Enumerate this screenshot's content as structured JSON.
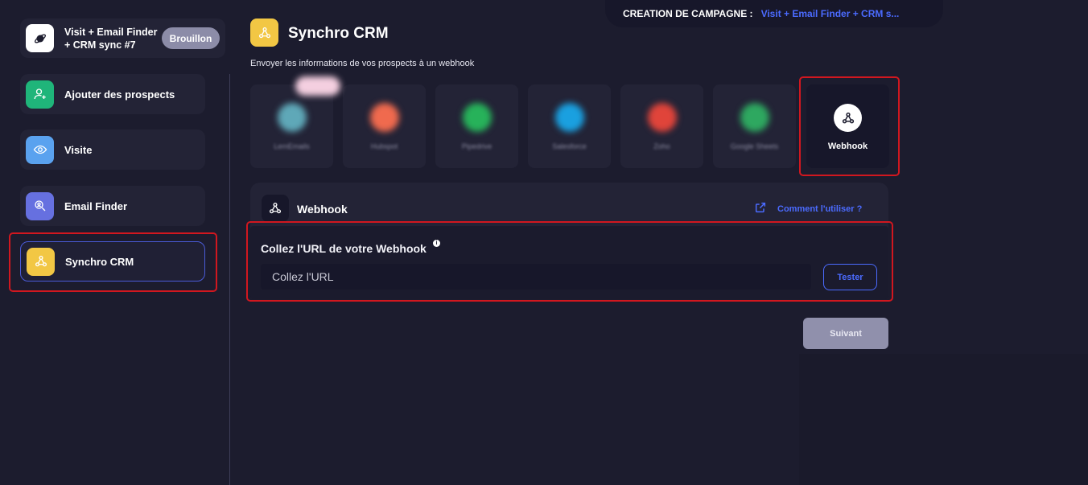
{
  "header": {
    "campaign_label": "CREATION DE CAMPAGNE :",
    "campaign_name": "Visit + Email Finder + CRM s..."
  },
  "sidebar": {
    "campaign": {
      "title": "Visit + Email Finder + CRM sync #7",
      "badge": "Brouillon"
    },
    "steps": [
      {
        "label": "Ajouter des prospects",
        "icon": "user-plus-icon",
        "color": "#1fb57a"
      },
      {
        "label": "Visite",
        "icon": "eye-icon",
        "color": "#5aa2ef"
      },
      {
        "label": "Email Finder",
        "icon": "search-user-icon",
        "color": "#6670e0"
      },
      {
        "label": "Synchro CRM",
        "icon": "webhook-icon",
        "color": "#f2c744"
      }
    ]
  },
  "main": {
    "title": "Synchro CRM",
    "subtitle": "Envoyer les informations de vos prospects à un webhook",
    "integrations": [
      {
        "label": "LemEmails",
        "color": "#5fa8b8"
      },
      {
        "label": "Hubspot",
        "color": "#f06a4e"
      },
      {
        "label": "Pipedrive",
        "color": "#27b25a"
      },
      {
        "label": "Salesforce",
        "color": "#1aa0e0"
      },
      {
        "label": "Zoho",
        "color": "#e0443a"
      },
      {
        "label": "Google Sheets",
        "color": "#2ea860"
      },
      {
        "label": "Webhook",
        "selected": true
      }
    ],
    "panel": {
      "title": "Webhook",
      "help_link": "Comment l'utiliser ?",
      "field_label": "Collez l'URL de votre Webhook",
      "info_symbol": "i",
      "url_placeholder": "Collez l'URL",
      "url_value": "",
      "test_button": "Tester"
    },
    "next_button": "Suivant"
  },
  "colors": {
    "background": "#1c1c2e",
    "accent": "#4b6bff",
    "highlight": "#d1171f",
    "yellow": "#f2c744"
  }
}
